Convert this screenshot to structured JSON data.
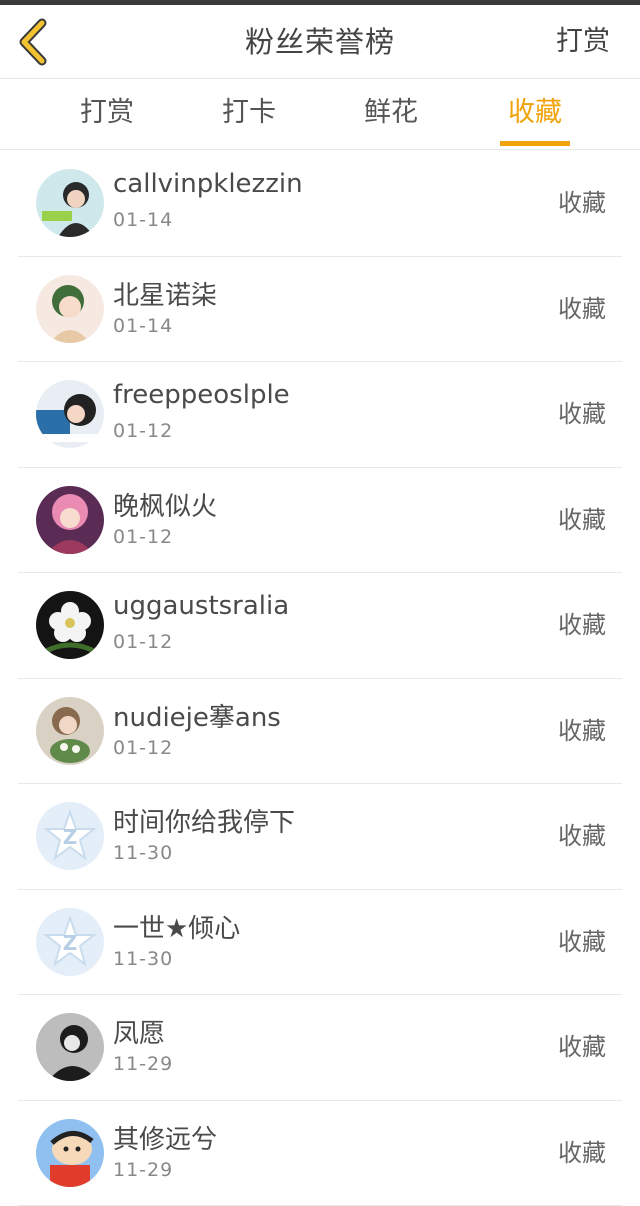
{
  "header": {
    "title": "粉丝荣誉榜",
    "action_label": "打赏"
  },
  "tabs": [
    {
      "label": "打赏"
    },
    {
      "label": "打卡"
    },
    {
      "label": "鲜花"
    },
    {
      "label": "收藏",
      "active": true
    }
  ],
  "colors": {
    "accent": "#f0a30a",
    "text": "#4a4a4a",
    "divider": "#e8e8e8"
  },
  "fans": [
    {
      "name": "callvinpklezzin",
      "date": "01-14",
      "action": "收藏",
      "avatar": "photo-girl-portrait"
    },
    {
      "name": "北星诺柒",
      "date": "01-14",
      "action": "收藏",
      "avatar": "anime-girl-green-hair"
    },
    {
      "name": "freeppeoslple",
      "date": "01-12",
      "action": "收藏",
      "avatar": "photo-girl-side"
    },
    {
      "name": "晚枫似火",
      "date": "01-12",
      "action": "收藏",
      "avatar": "anime-girl-pink"
    },
    {
      "name": "uggaustsralia",
      "date": "01-12",
      "action": "收藏",
      "avatar": "white-flower"
    },
    {
      "name": "nudieje搴ans",
      "date": "01-12",
      "action": "收藏",
      "avatar": "photo-girl-flowers"
    },
    {
      "name": "时间你给我停下",
      "date": "11-30",
      "action": "收藏",
      "avatar": "default-star"
    },
    {
      "name": "一世★倾心",
      "date": "11-30",
      "action": "收藏",
      "avatar": "default-star"
    },
    {
      "name": "凤愿",
      "date": "11-29",
      "action": "收藏",
      "avatar": "sketch-boy"
    },
    {
      "name": "其修远兮",
      "date": "11-29",
      "action": "收藏",
      "avatar": "cartoon-boy"
    }
  ]
}
